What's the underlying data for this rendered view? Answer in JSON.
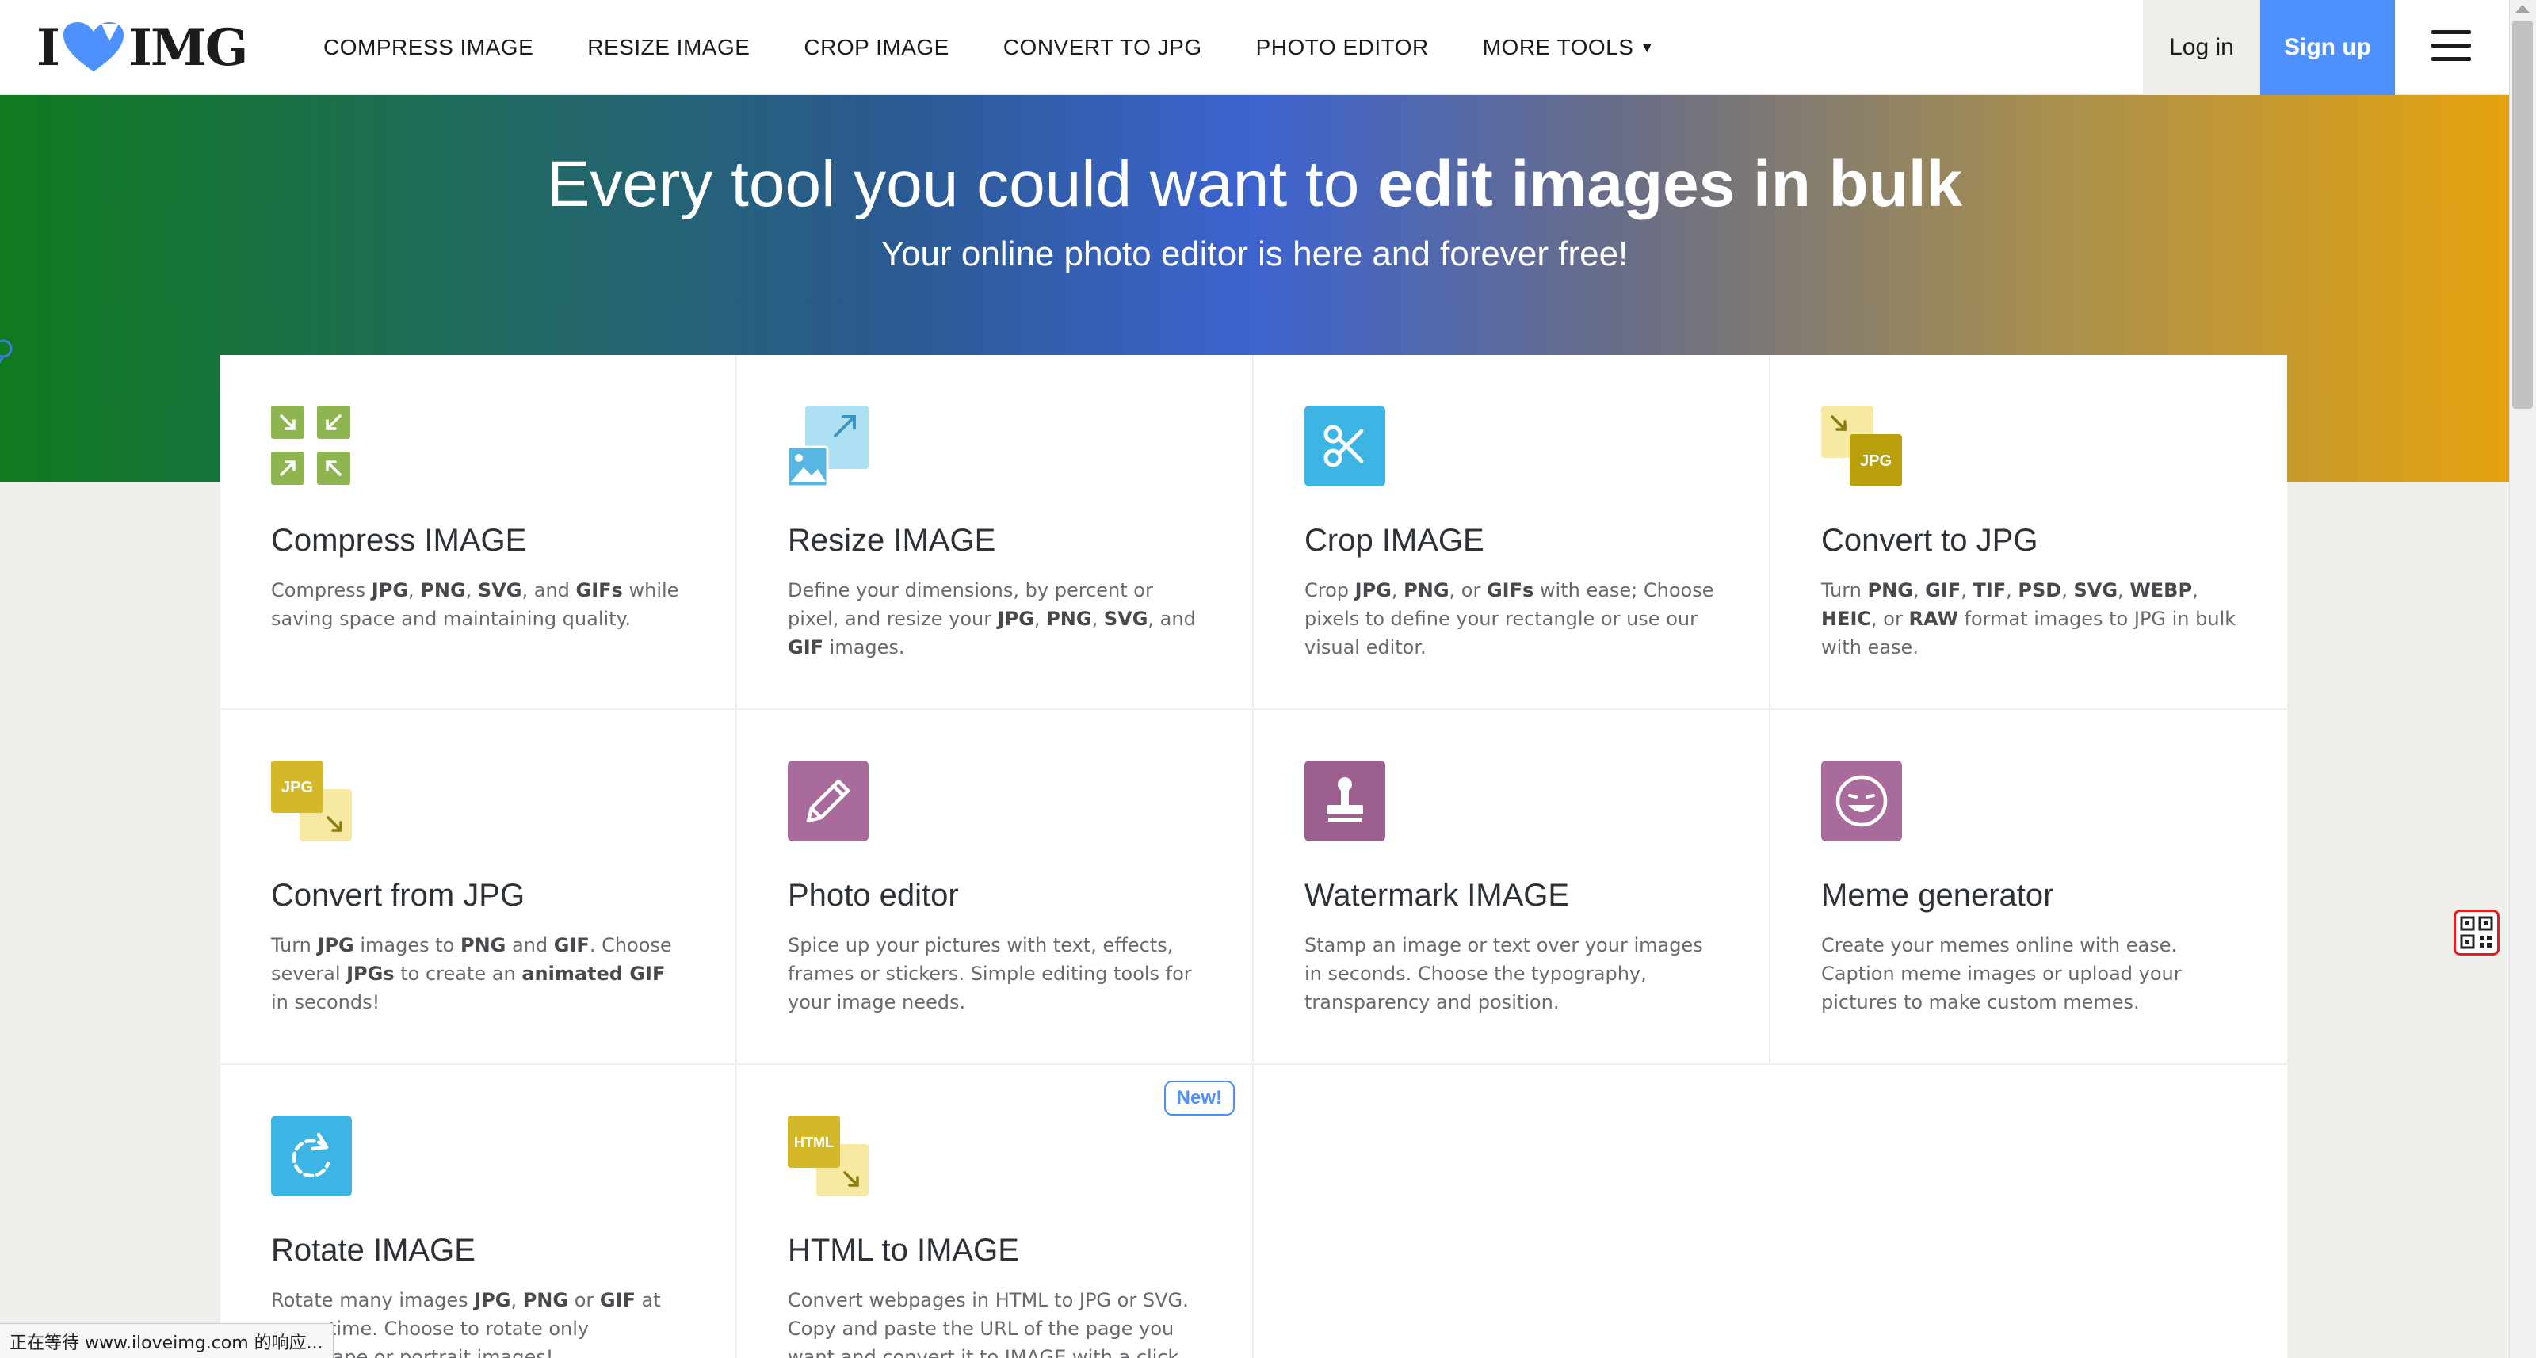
{
  "brand": {
    "logo_left": "I",
    "logo_right": "IMG",
    "heart_color": "#4d90fe"
  },
  "nav": {
    "links": [
      {
        "label": "COMPRESS IMAGE"
      },
      {
        "label": "RESIZE IMAGE"
      },
      {
        "label": "CROP IMAGE"
      },
      {
        "label": "CONVERT TO JPG"
      },
      {
        "label": "PHOTO EDITOR"
      },
      {
        "label": "MORE TOOLS"
      }
    ],
    "login": "Log in",
    "signup": "Sign up",
    "menu_icon": "hamburger-icon"
  },
  "hero": {
    "title_normal": "Every tool you could want to ",
    "title_bold": "edit images in bulk",
    "subtitle": "Your online photo editor is here and forever free!"
  },
  "tools": [
    {
      "title": "Compress IMAGE",
      "icon": "compress-icon",
      "color": "#8fb550",
      "desc": [
        [
          "Compress ",
          false
        ],
        [
          "JPG",
          true
        ],
        [
          ", ",
          false
        ],
        [
          "PNG",
          true
        ],
        [
          ", ",
          false
        ],
        [
          "SVG",
          true
        ],
        [
          ", and ",
          false
        ],
        [
          "GIFs",
          true
        ],
        [
          " while saving space and maintaining quality.",
          false
        ]
      ]
    },
    {
      "title": "Resize IMAGE",
      "icon": "resize-icon",
      "color": "#58b7e2",
      "desc": [
        [
          "Define your dimensions, by percent or pixel, and resize your ",
          false
        ],
        [
          "JPG",
          true
        ],
        [
          ", ",
          false
        ],
        [
          "PNG",
          true
        ],
        [
          ", ",
          false
        ],
        [
          "SVG",
          true
        ],
        [
          ", and ",
          false
        ],
        [
          "GIF",
          true
        ],
        [
          " images.",
          false
        ]
      ]
    },
    {
      "title": "Crop IMAGE",
      "icon": "scissors-icon",
      "color": "#3cb5e5",
      "desc": [
        [
          "Crop ",
          false
        ],
        [
          "JPG",
          true
        ],
        [
          ", ",
          false
        ],
        [
          "PNG",
          true
        ],
        [
          ", or ",
          false
        ],
        [
          "GIFs",
          true
        ],
        [
          " with ease; Choose pixels to define your rectangle or use our visual editor.",
          false
        ]
      ]
    },
    {
      "title": "Convert to JPG",
      "icon": "convert-to-jpg-icon",
      "color": "#b9a00a",
      "badge_text": "JPG",
      "desc": [
        [
          "Turn ",
          false
        ],
        [
          "PNG",
          true
        ],
        [
          ", ",
          false
        ],
        [
          "GIF",
          true
        ],
        [
          ", ",
          false
        ],
        [
          "TIF",
          true
        ],
        [
          ", ",
          false
        ],
        [
          "PSD",
          true
        ],
        [
          ", ",
          false
        ],
        [
          "SVG",
          true
        ],
        [
          ", ",
          false
        ],
        [
          "WEBP",
          true
        ],
        [
          ", ",
          false
        ],
        [
          "HEIC",
          true
        ],
        [
          ", or ",
          false
        ],
        [
          "RAW",
          true
        ],
        [
          " format images to JPG in bulk with ease.",
          false
        ]
      ]
    },
    {
      "title": "Convert from JPG",
      "icon": "convert-from-jpg-icon",
      "color": "#d4b82a",
      "badge_text": "JPG",
      "desc": [
        [
          "Turn ",
          false
        ],
        [
          "JPG",
          true
        ],
        [
          " images to ",
          false
        ],
        [
          "PNG",
          true
        ],
        [
          " and ",
          false
        ],
        [
          "GIF",
          true
        ],
        [
          ". Choose several ",
          false
        ],
        [
          "JPGs",
          true
        ],
        [
          " to create an ",
          false
        ],
        [
          "animated GIF",
          true
        ],
        [
          " in seconds!",
          false
        ]
      ]
    },
    {
      "title": "Photo editor",
      "icon": "pencil-icon",
      "color": "#a86b9c",
      "desc": [
        [
          "Spice up your pictures with text, effects, frames or stickers. Simple editing tools for your image needs.",
          false
        ]
      ]
    },
    {
      "title": "Watermark IMAGE",
      "icon": "stamp-icon",
      "color": "#9d5f8f",
      "desc": [
        [
          "Stamp an image or text over your images in seconds. Choose the typography, transparency and position.",
          false
        ]
      ]
    },
    {
      "title": "Meme generator",
      "icon": "laughing-face-icon",
      "color": "#a86b9c",
      "desc": [
        [
          "Create your memes online with ease. Caption meme images or upload your pictures to make custom memes.",
          false
        ]
      ]
    },
    {
      "title": "Rotate IMAGE",
      "icon": "rotate-icon",
      "color": "#3cb5e5",
      "desc": [
        [
          "Rotate many images ",
          false
        ],
        [
          "JPG",
          true
        ],
        [
          ", ",
          false
        ],
        [
          "PNG",
          true
        ],
        [
          " or ",
          false
        ],
        [
          "GIF",
          true
        ],
        [
          " at same time. Choose to rotate only landscape or portrait images!",
          false
        ]
      ]
    },
    {
      "title": "HTML to IMAGE",
      "icon": "html-to-image-icon",
      "color": "#d4b82a",
      "badge_text": "HTML",
      "new_label": "New!",
      "desc": [
        [
          "Convert webpages in HTML to JPG or SVG. Copy and paste the URL of the page you want and convert it to IMAGE with a click.",
          false
        ]
      ]
    }
  ],
  "qr_icon": "qr-code-icon",
  "status_text": "正在等待 www.iloveimg.com 的响应..."
}
